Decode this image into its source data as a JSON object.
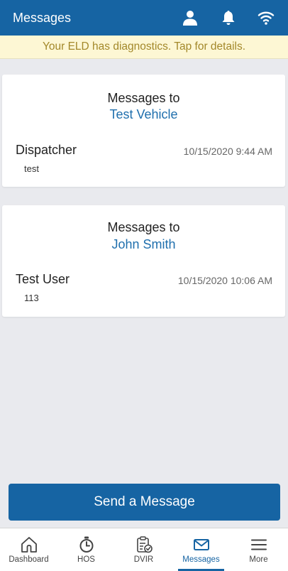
{
  "header": {
    "title": "Messages",
    "icons": [
      "profile-icon",
      "bell-icon",
      "wifi-icon"
    ]
  },
  "banner": {
    "text": "Your ELD has diagnostics. Tap for details."
  },
  "conversations": [
    {
      "heading": "Messages to",
      "recipient": "Test Vehicle",
      "sender": "Dispatcher",
      "timestamp": "10/15/2020 9:44 AM",
      "preview": "test"
    },
    {
      "heading": "Messages to",
      "recipient": "John Smith",
      "sender": "Test User",
      "timestamp": "10/15/2020 10:06 AM",
      "preview": "113"
    }
  ],
  "send_button": {
    "label": "Send a Message"
  },
  "tabs": [
    {
      "label": "Dashboard",
      "icon": "home-icon",
      "active": false
    },
    {
      "label": "HOS",
      "icon": "stopwatch-icon",
      "active": false
    },
    {
      "label": "DVIR",
      "icon": "clipboard-check-icon",
      "active": false
    },
    {
      "label": "Messages",
      "icon": "envelope-icon",
      "active": true
    },
    {
      "label": "More",
      "icon": "menu-icon",
      "active": false
    }
  ],
  "colors": {
    "primary": "#1664a3",
    "banner_bg": "#fdf7d4",
    "banner_text": "#a3882a",
    "background": "#e9eaee"
  }
}
